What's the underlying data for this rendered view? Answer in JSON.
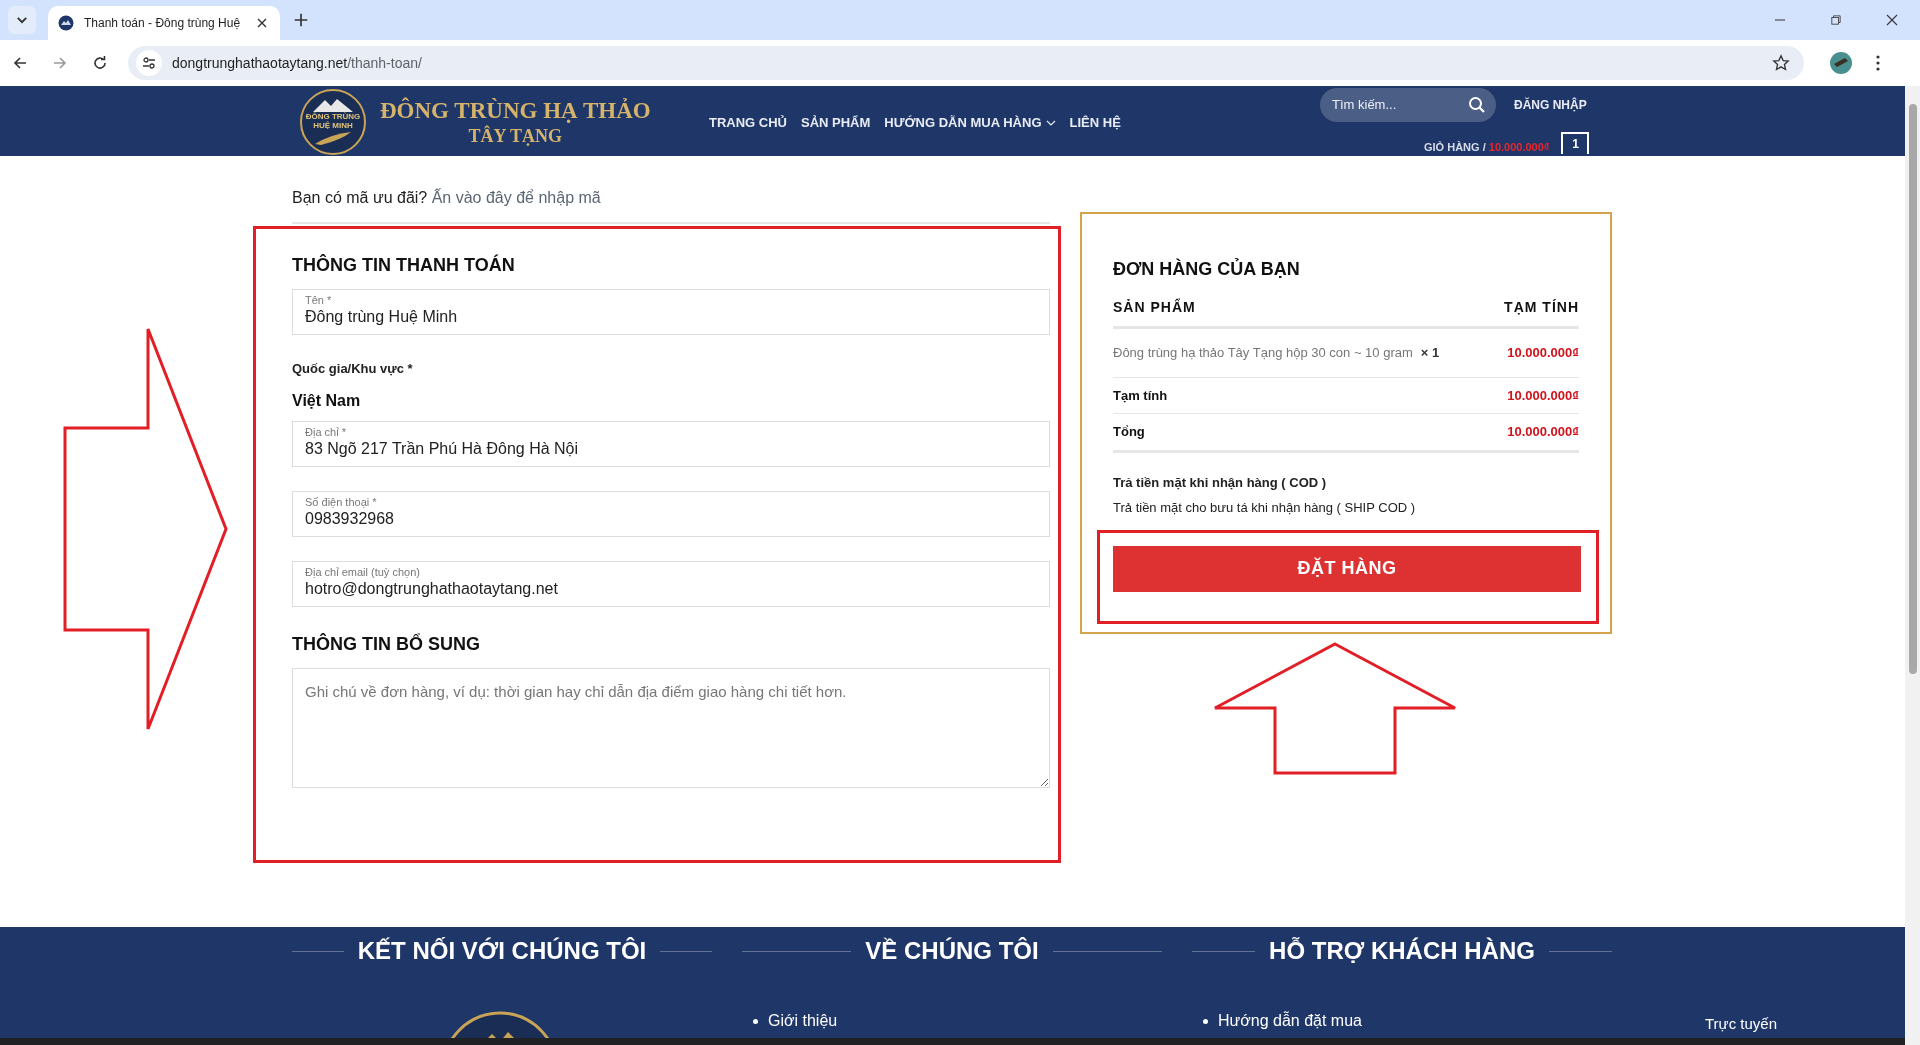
{
  "browser": {
    "tab_title": "Thanh toán - Đông trùng Huệ",
    "url_host": "dongtrunghathaotaytang.net",
    "url_path": "/thanh-toan/"
  },
  "header": {
    "logo_badge": "ĐÔNG TRÙNG HUỆ MINH",
    "logo_title": "ĐÔNG TRÙNG HẠ THẢO",
    "logo_subtitle": "TÂY TẠNG",
    "nav": [
      {
        "label": "TRANG CHỦ",
        "has_dropdown": false
      },
      {
        "label": "SẢN PHẨM",
        "has_dropdown": false
      },
      {
        "label": "HƯỚNG DẪN MUA HÀNG",
        "has_dropdown": true
      },
      {
        "label": "LIÊN HỆ",
        "has_dropdown": false
      }
    ],
    "search": {
      "placeholder": "Tìm kiếm..."
    },
    "login": "ĐĂNG NHẬP",
    "cart_label": "GIỎ HÀNG /",
    "cart_total": "10.000.000₫",
    "cart_count": "1"
  },
  "coupon": {
    "prompt": "Bạn có mã ưu đãi?",
    "link": "Ấn vào đây để nhập mã"
  },
  "billing": {
    "heading": "THÔNG TIN THANH TOÁN",
    "highlighted": true,
    "fields": [
      {
        "kind": "input",
        "label": "Tên *",
        "value": "Đông trùng Huệ Minh"
      },
      {
        "kind": "static",
        "label": "Quốc gia/Khu vực *",
        "value": "Việt Nam"
      },
      {
        "kind": "input",
        "label": "Địa chỉ *",
        "value": "83 Ngõ 217 Trần Phú Hà Đông Hà Nội"
      },
      {
        "kind": "input",
        "label": "Số điện thoại *",
        "value": "0983932968"
      },
      {
        "kind": "input",
        "label": "Địa chỉ email (tuỳ chọn)",
        "value": "hotro@dongtrunghathaotaytang.net"
      }
    ]
  },
  "additional": {
    "heading": "THÔNG TIN BỔ SUNG",
    "notes_placeholder": "Ghi chú về đơn hàng, ví dụ: thời gian hay chỉ dẫn địa điểm giao hàng chi tiết hơn."
  },
  "order": {
    "heading": "ĐƠN HÀNG CỦA BẠN",
    "columns": [
      "SẢN PHẨM",
      "TẠM TÍNH"
    ],
    "items": [
      {
        "name": "Đông trùng hạ thảo Tây Tạng hộp 30 con ~ 10 gram",
        "quantity": "× 1",
        "price": "10.000.000₫"
      }
    ],
    "totals": [
      {
        "label": "Tạm tính",
        "value": "10.000.000₫"
      },
      {
        "label": "Tổng",
        "value": "10.000.000₫"
      }
    ],
    "payment_title": "Trả tiền mặt khi nhận hàng ( COD )",
    "payment_description": "Trả tiền mặt cho bưu tá khi nhận hàng ( SHIP COD )",
    "button": "ĐẶT HÀNG",
    "button_highlighted": true
  },
  "annotations": [
    {
      "kind": "arrow-right"
    },
    {
      "kind": "arrow-up"
    }
  ],
  "footer": {
    "columns": [
      {
        "heading": "KẾT NỐI VỚI CHÚNG TÔI"
      },
      {
        "heading": "VỀ CHÚNG TÔI",
        "links": [
          "Giới thiệu"
        ]
      },
      {
        "heading": "HỖ TRỢ KHÁCH HÀNG",
        "links": [
          "Hướng dẫn đặt mua"
        ]
      }
    ],
    "aside": "Trực tuyến"
  }
}
